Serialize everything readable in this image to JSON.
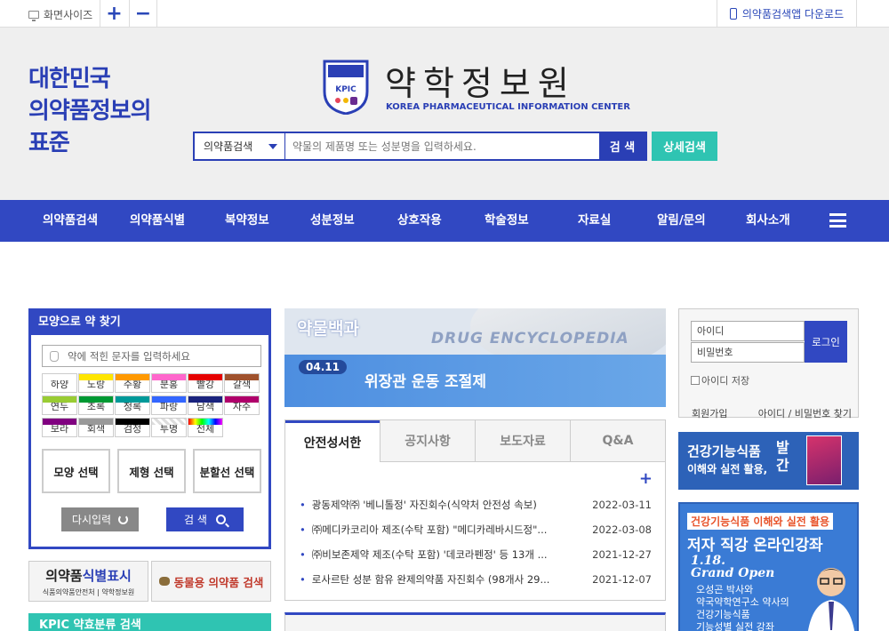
{
  "topbar": {
    "screen_size_label": "화면사이즈",
    "zoom_in": "+",
    "zoom_out": "−",
    "app_download": "의약품검색앱 다운로드"
  },
  "header": {
    "slogan_lines": [
      "대한민국",
      "의약품정보의",
      "표준"
    ],
    "logo_title": "약학정보원",
    "logo_sub": "KOREA PHARMACEUTICAL INFORMATION CENTER",
    "logo_emblem_text": "KPIC",
    "search": {
      "category": "의약품검색",
      "placeholder": "약물의 제품명 또는 성분명을 입력하세요.",
      "button": "검 색",
      "detail_button": "상세검색"
    }
  },
  "nav": {
    "items": [
      "의약품검색",
      "의약품식별",
      "복약정보",
      "성분정보",
      "상호작용",
      "학술정보",
      "자료실",
      "알림/문의",
      "회사소개"
    ]
  },
  "shape_search": {
    "title": "모양으로 약 찾기",
    "placeholder": "약에 적힌 문자를 입력하세요",
    "colors": [
      {
        "label": "하양",
        "hex": "#ffffff"
      },
      {
        "label": "노랑",
        "hex": "#ffe600"
      },
      {
        "label": "주황",
        "hex": "#ff9900"
      },
      {
        "label": "분홍",
        "hex": "#ff66cc"
      },
      {
        "label": "빨강",
        "hex": "#e60000"
      },
      {
        "label": "갈색",
        "hex": "#a0522d"
      },
      {
        "label": "연두",
        "hex": "#99cc33"
      },
      {
        "label": "초록",
        "hex": "#009933"
      },
      {
        "label": "청록",
        "hex": "#009999"
      },
      {
        "label": "파랑",
        "hex": "#3366ff"
      },
      {
        "label": "남색",
        "hex": "#1a237e"
      },
      {
        "label": "자주",
        "hex": "#b0006b"
      },
      {
        "label": "보라",
        "hex": "#800080"
      },
      {
        "label": "회색",
        "hex": "#999999"
      },
      {
        "label": "검정",
        "hex": "#000000"
      },
      {
        "label": "투명",
        "hex": "transparent"
      },
      {
        "label": "전체",
        "hex": "rainbow"
      }
    ],
    "buttons": [
      "모양 선택",
      "제형 선택",
      "분할선 선택"
    ],
    "reset": "다시입력",
    "find": "검 색"
  },
  "banners": {
    "id_title_a": "의약품",
    "id_title_b": "식별표시",
    "id_sub": "식품의약품안전처 | 약학정보원",
    "animal": "동물용 의약품 검색",
    "kpic_class": "KPIC 약효분류 검색"
  },
  "encyclopedia": {
    "label": "약물백과",
    "english": "DRUG ENCYCLOPEDIA",
    "date": "04.11",
    "topic": "위장관 운동 조절제"
  },
  "notice": {
    "tabs": [
      "안전성서한",
      "공지사항",
      "보도자료",
      "Q&A"
    ],
    "more": "+",
    "items": [
      {
        "title": "광동제약㈜ '베니톨정' 자진회수(식약처 안전성 속보)",
        "date": "2022-03-11"
      },
      {
        "title": "㈜메디카코리아 제조(수탁 포함) \"메디카레바시드정\"...",
        "date": "2022-03-08"
      },
      {
        "title": "㈜비보존제약 제조(수탁 포함) '데코라펜정' 등 13개 ...",
        "date": "2021-12-27"
      },
      {
        "title": "로사르탄 성분 함유 완제의약품 자진회수 (98개사 29...",
        "date": "2021-12-07"
      }
    ]
  },
  "login": {
    "id_placeholder": "아이디",
    "pw_placeholder": "비밀번호",
    "button": "로그인",
    "save_id": "아이디 저장",
    "join": "회원가입",
    "find": "아이디 / 비밀번호 찾기"
  },
  "book_banner": {
    "title_a": "건강기능식품",
    "subtitle": "이해와 실전 활용,",
    "tag": "발간"
  },
  "lecture": {
    "top": "건강기능식품 이해와 실전 활용",
    "main": "저자 직강 온라인강좌",
    "date": "1.18.",
    "grand": "Grand Open",
    "desc": [
      "오성곤 박사와",
      "약국약학연구소 약사의",
      "건강기능식품",
      "기능성별 실전 강좌"
    ]
  }
}
